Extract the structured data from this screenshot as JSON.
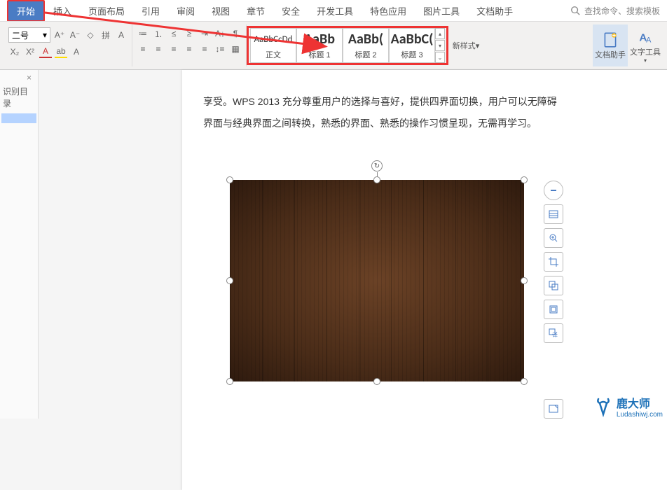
{
  "menu": {
    "items": [
      "开始",
      "插入",
      "页面布局",
      "引用",
      "审阅",
      "视图",
      "章节",
      "安全",
      "开发工具",
      "特色应用",
      "图片工具",
      "文档助手"
    ],
    "search_placeholder": "查找命令、搜索模板"
  },
  "ribbon": {
    "font_size": "二号",
    "styles": [
      {
        "preview": "AaBbCcDd",
        "label": "正文"
      },
      {
        "preview": "AaBb",
        "label": "标题 1"
      },
      {
        "preview": "AaBb(",
        "label": "标题 2"
      },
      {
        "preview": "AaBbC(",
        "label": "标题 3"
      }
    ],
    "new_style": "新样式",
    "doc_assist": "文档助手",
    "text_tool": "文字工具"
  },
  "outline": {
    "title": "识别目录"
  },
  "document": {
    "para1": "享受。WPS 2013 充分尊重用户的选择与喜好，提供四界面切换，用户可以无障碍",
    "para2": "界面与经典界面之间转换，熟悉的界面、熟悉的操作习惯呈现，无需再学习。"
  },
  "float_toolbar": {
    "buttons": [
      "collapse",
      "layout",
      "zoom",
      "crop",
      "effects",
      "link",
      "more",
      "extra"
    ]
  },
  "watermark": {
    "brand": "鹿大师",
    "url": "Ludashiwj.com"
  }
}
